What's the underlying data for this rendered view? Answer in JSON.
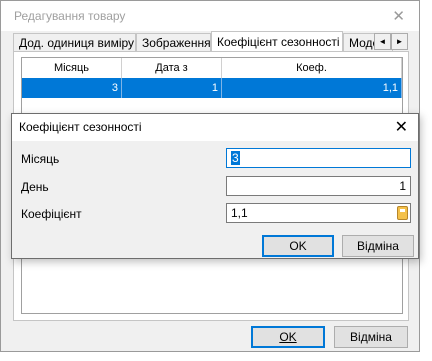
{
  "parent_window": {
    "title": "Редагування товару",
    "tabs": [
      {
        "label": "Дод. одиниця виміру",
        "active": false
      },
      {
        "label": "Зображення",
        "active": false
      },
      {
        "label": "Коефіцієнт сезонності",
        "active": true
      },
      {
        "label": "Моделі",
        "active": false
      }
    ],
    "tab_scroll_left": "◄",
    "tab_scroll_right": "►",
    "grid": {
      "columns": [
        "Місяць",
        "Дата з",
        "Коеф."
      ],
      "rows": [
        {
          "cells": [
            "3",
            "1",
            "1,1"
          ],
          "selected": true
        }
      ]
    },
    "ok_label": "OK",
    "cancel_label": "Відміна"
  },
  "dialog": {
    "title": "Коефіцієнт сезонності",
    "fields": {
      "month": {
        "label": "Місяць",
        "value": "3"
      },
      "day": {
        "label": "День",
        "value": "1"
      },
      "coefficient": {
        "label": "Коефіцієнт",
        "value": "1,1"
      }
    },
    "ok_label": "OK",
    "cancel_label": "Відміна"
  },
  "colors": {
    "selection": "#0078d7",
    "window_bg": "#f0f0f0",
    "title_inactive": "#a0a0a0"
  },
  "icons": {
    "close": "close-icon",
    "calculator": "calculator-icon"
  }
}
